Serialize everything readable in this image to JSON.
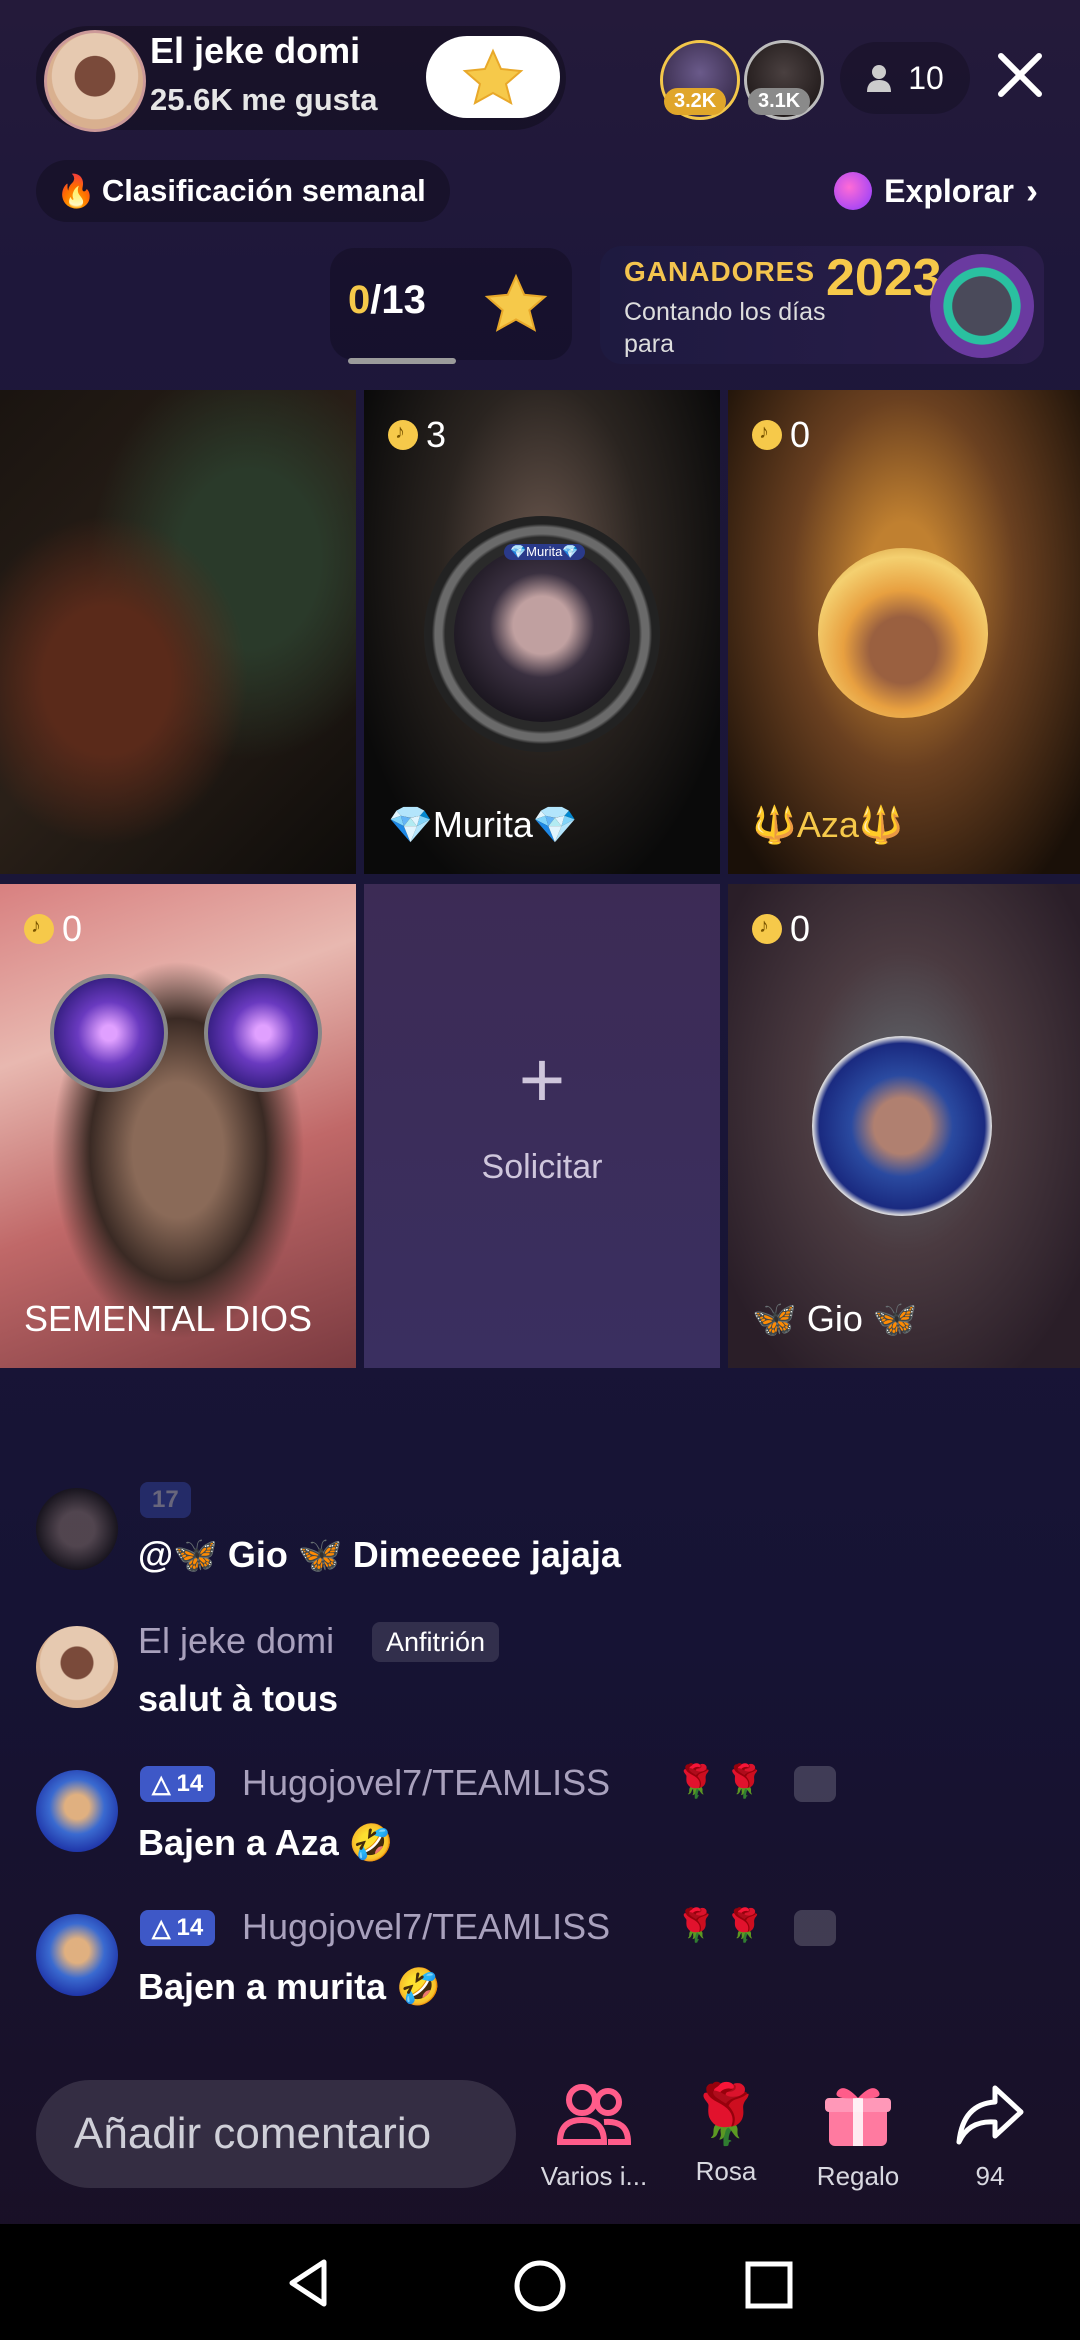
{
  "host": {
    "name": "El jeke domi",
    "likes": "25.6K me gusta"
  },
  "viewers": [
    {
      "count": "3.2K"
    },
    {
      "count": "3.1K"
    }
  ],
  "people_count": "10",
  "weekly_rank": "Clasificación semanal",
  "explore": "Explorar",
  "counter": {
    "current": "0",
    "total": "/13"
  },
  "winners": {
    "title": "GANADORES",
    "subtitle": "Contando los días para",
    "year": "2023"
  },
  "tiles": [
    {
      "name": "",
      "coins": ""
    },
    {
      "name": "💎Murita💎",
      "coins": "3",
      "frame_text": "💎Murita💎"
    },
    {
      "name": "🔱Aza🔱",
      "coins": "0"
    },
    {
      "name": "SEMENTAL DIOS",
      "coins": "0"
    },
    {
      "name": "Solicitar",
      "coins": ""
    },
    {
      "name": "🦋 Gio 🦋",
      "coins": "0"
    }
  ],
  "comments": [
    {
      "user": "",
      "text": "@🦋 Gio 🦋 Dimeeeee jajaja",
      "level": "17"
    },
    {
      "user": "El jeke domi",
      "tag": "Anfitrión",
      "text": "salut à tous"
    },
    {
      "user": "Hugojovel7/TEAMLISS",
      "level": "14",
      "roses": "🌹 🌹",
      "text": "Bajen a Aza 🤣"
    },
    {
      "user": "Hugojovel7/TEAMLISS",
      "level": "14",
      "roses": "🌹 🌹",
      "text": "Bajen a murita 🤣"
    }
  ],
  "comment_placeholder": "Añadir comentario",
  "actions": [
    {
      "label": "Varios i...",
      "icon": "multi-guest-icon"
    },
    {
      "label": "Rosa",
      "icon": "rose-icon"
    },
    {
      "label": "Regalo",
      "icon": "gift-icon"
    },
    {
      "label": "94",
      "icon": "share-icon"
    }
  ],
  "colors": {
    "accent_pink": "#ff5c8a",
    "coin": "#f6c94a",
    "level_badge": "#3e58c7"
  }
}
